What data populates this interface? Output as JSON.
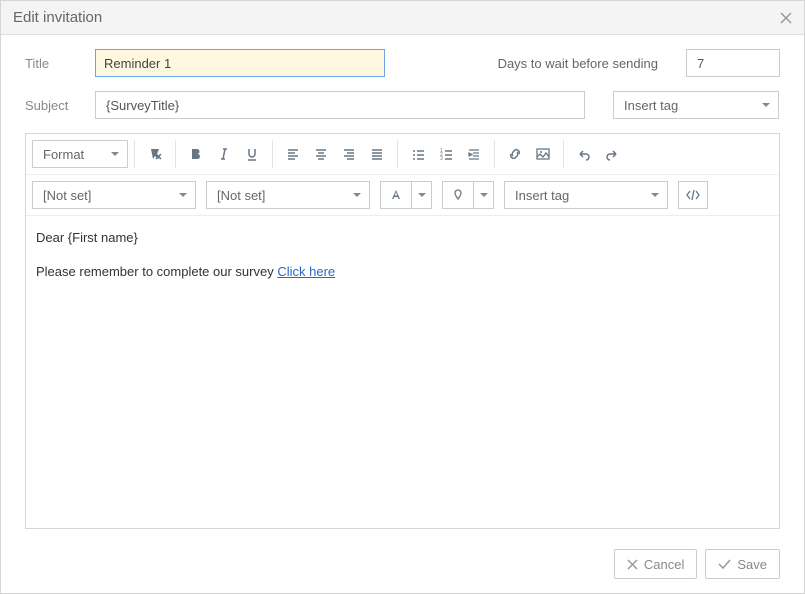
{
  "header": {
    "title": "Edit invitation"
  },
  "form": {
    "title_label": "Title",
    "title_value": "Reminder 1",
    "days_label": "Days to wait before sending",
    "days_value": "7",
    "subject_label": "Subject",
    "subject_value": "{SurveyTitle}",
    "insert_tag_label": "Insert tag"
  },
  "toolbar": {
    "format_label": "Format",
    "font_family_value": "[Not set]",
    "font_size_value": "[Not set]",
    "insert_tag_label": "Insert tag"
  },
  "editor": {
    "greeting": "Dear {First name}",
    "body_prefix": "Please remember to complete our survey ",
    "link_text": "Click here"
  },
  "footer": {
    "cancel_label": "Cancel",
    "save_label": "Save"
  }
}
